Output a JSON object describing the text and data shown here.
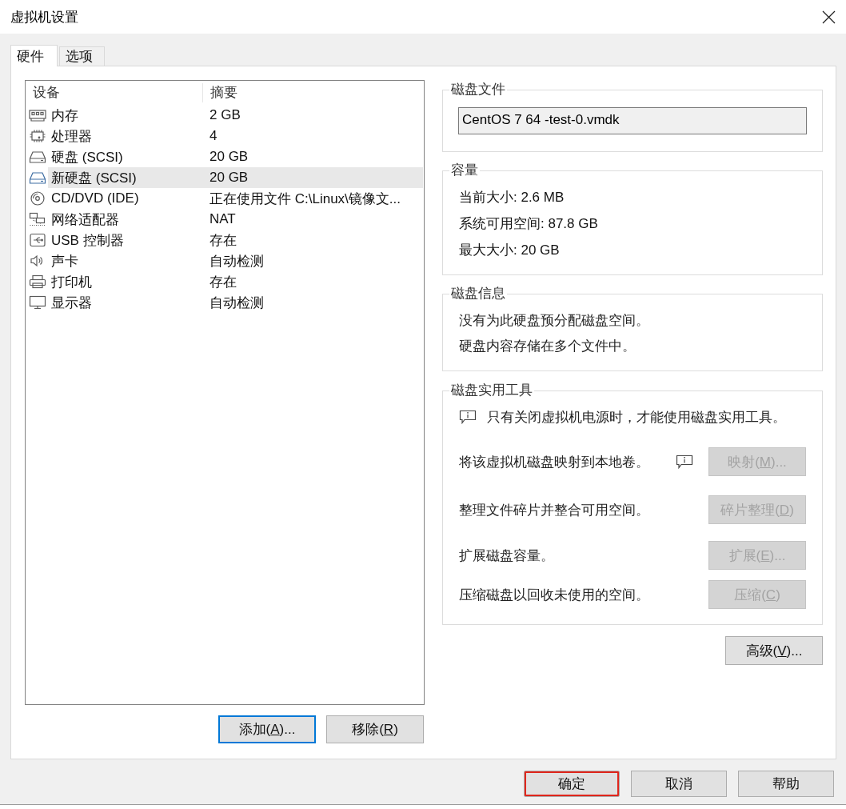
{
  "window": {
    "title": "虚拟机设置"
  },
  "tabs": [
    {
      "label": "硬件",
      "selected": true
    },
    {
      "label": "选项",
      "selected": false
    }
  ],
  "device_list": {
    "columns": [
      "设备",
      "摘要"
    ],
    "rows": [
      {
        "kind": "memory",
        "name": "内存",
        "summary": "2 GB",
        "selected": false
      },
      {
        "kind": "processor",
        "name": "处理器",
        "summary": "4",
        "selected": false
      },
      {
        "kind": "disk",
        "name": "硬盘 (SCSI)",
        "summary": "20 GB",
        "selected": false
      },
      {
        "kind": "disk",
        "name": "新硬盘 (SCSI)",
        "summary": "20 GB",
        "selected": true
      },
      {
        "kind": "cd",
        "name": "CD/DVD (IDE)",
        "summary": "正在使用文件 C:\\Linux\\镜像文...",
        "selected": false
      },
      {
        "kind": "network",
        "name": "网络适配器",
        "summary": "NAT",
        "selected": false
      },
      {
        "kind": "usb",
        "name": "USB 控制器",
        "summary": "存在",
        "selected": false
      },
      {
        "kind": "sound",
        "name": "声卡",
        "summary": "自动检测",
        "selected": false
      },
      {
        "kind": "printer",
        "name": "打印机",
        "summary": "存在",
        "selected": false
      },
      {
        "kind": "display",
        "name": "显示器",
        "summary": "自动检测",
        "selected": false
      }
    ]
  },
  "device_buttons": [
    {
      "label_before": "添加(",
      "access_key": "A",
      "label_after": ")...",
      "focused": true
    },
    {
      "label_before": "移除(",
      "access_key": "R",
      "label_after": ")",
      "focused": false
    }
  ],
  "disk_file": {
    "title": "磁盘文件",
    "value": "CentOS 7 64 -test-0.vmdk"
  },
  "capacity": {
    "title": "容量",
    "lines": [
      "当前大小: 2.6 MB",
      "系统可用空间: 87.8 GB",
      "最大大小: 20 GB"
    ]
  },
  "disk_info": {
    "title": "磁盘信息",
    "lines": [
      "没有为此硬盘预分配磁盘空间。",
      "硬盘内容存储在多个文件中。"
    ]
  },
  "disk_utilities": {
    "title": "磁盘实用工具",
    "notice": "只有关闭虚拟机电源时，才能使用磁盘实用工具。",
    "actions": [
      {
        "description": "将该虚拟机磁盘映射到本地卷。",
        "info_icon": true,
        "button": {
          "label_before": "映射(",
          "access_key": "M",
          "label_after": ")...",
          "disabled": true
        }
      },
      {
        "description": "整理文件碎片并整合可用空间。",
        "info_icon": false,
        "button": {
          "label_before": "碎片整理(",
          "access_key": "D",
          "label_after": ")",
          "disabled": true
        }
      },
      {
        "description": "扩展磁盘容量。",
        "info_icon": false,
        "button": {
          "label_before": "扩展(",
          "access_key": "E",
          "label_after": ")...",
          "disabled": true
        }
      },
      {
        "description": "压缩磁盘以回收未使用的空间。",
        "info_icon": false,
        "button": {
          "label_before": "压缩(",
          "access_key": "C",
          "label_after": ")",
          "disabled": true
        }
      }
    ]
  },
  "advanced_button": {
    "label_before": "高级(",
    "access_key": "V",
    "label_after": ")..."
  },
  "dialog_buttons": [
    {
      "label": "确定",
      "highlighted": true
    },
    {
      "label": "取消",
      "highlighted": false
    },
    {
      "label": "帮助",
      "highlighted": false
    }
  ]
}
